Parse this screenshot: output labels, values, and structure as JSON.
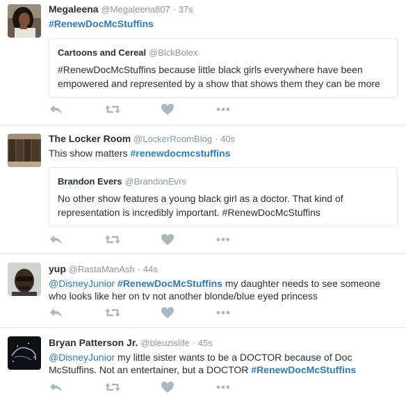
{
  "tweets": [
    {
      "name": "Megaleena",
      "handle": "@Megaleena807",
      "time": "37s",
      "text_parts": [
        {
          "type": "tag",
          "text": "#RenewDocMcStuffins"
        }
      ],
      "quote": {
        "name": "Cartoons and Cereal",
        "handle": "@BlckBolex",
        "text": "#RenewDocMcStuffins because little black girls everywhere have been empowered and represented by a show that shows them they can be more"
      }
    },
    {
      "name": "The Locker Room",
      "handle": "@LockerRoomBlog",
      "time": "40s",
      "text_parts": [
        {
          "type": "plain",
          "text": "This show matters "
        },
        {
          "type": "tag",
          "text": "#renewdocmcstuffins"
        }
      ],
      "quote": {
        "name": "Brandon Evers",
        "handle": "@BrandonEvrs",
        "text": "No other show features a young black girl as a doctor. That kind of representation is incredibly important. #RenewDocMcStuffins"
      }
    },
    {
      "name": "yup",
      "handle": "@RastaManAsh",
      "time": "44s",
      "text_parts": [
        {
          "type": "mention",
          "text": "@DisneyJunior"
        },
        {
          "type": "plain",
          "text": " "
        },
        {
          "type": "tag",
          "text": "#RenewDocMcStuffins"
        },
        {
          "type": "plain",
          "text": " my daughter needs to see someone who looks like her on tv not another blonde/blue eyed princess"
        }
      ]
    },
    {
      "name": "Bryan Patterson Jr.",
      "handle": "@bleuzislife",
      "time": "45s",
      "text_parts": [
        {
          "type": "mention",
          "text": "@DisneyJunior"
        },
        {
          "type": "plain",
          "text": " my little sister wants to be a DOCTOR because of Doc McStuffins. Not an entertainer, but a DOCTOR "
        },
        {
          "type": "tag",
          "text": "#RenewDocMcStuffins"
        }
      ]
    }
  ],
  "separator": "·",
  "action_icons": [
    "reply-icon",
    "retweet-icon",
    "like-icon",
    "more-icon"
  ],
  "colors": {
    "link": "#2b7bb9",
    "muted": "#8899a6",
    "icon": "#aab8c2",
    "border": "#e1e8ed",
    "text": "#292f33"
  }
}
